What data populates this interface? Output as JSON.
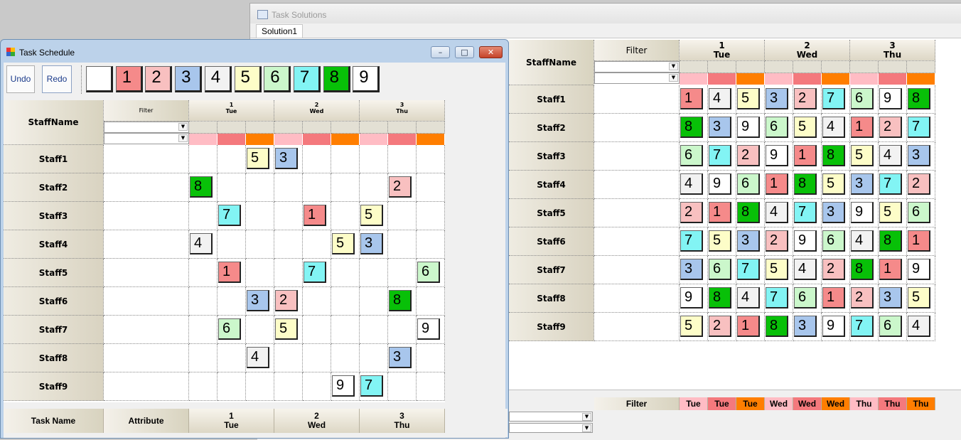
{
  "colors": {
    "1": "#f58a8a",
    "2": "#f8c0c0",
    "3": "#a8c6ec",
    "4": "#f2f2f2",
    "5": "#fdfdc8",
    "6": "#cbf7cb",
    "7": "#82f4f4",
    "8": "#08c008",
    "9": "#ffffff",
    "blank": "#ffffff",
    "pink": "#ffbcc4",
    "red": "#f4797d",
    "orange": "#ff7e00"
  },
  "solutions": {
    "title": "Task Solutions",
    "tab": "Solution1",
    "grid": {
      "header_staff": "StaffName",
      "header_filter": "Filter",
      "days": [
        {
          "num": "1",
          "name": "Tue"
        },
        {
          "num": "2",
          "name": "Wed"
        },
        {
          "num": "3",
          "name": "Thu"
        }
      ],
      "rows": [
        {
          "name": "Staff1",
          "cells": [
            1,
            4,
            5,
            3,
            2,
            7,
            6,
            9,
            8
          ]
        },
        {
          "name": "Staff2",
          "cells": [
            8,
            3,
            9,
            6,
            5,
            4,
            1,
            2,
            7
          ]
        },
        {
          "name": "Staff3",
          "cells": [
            6,
            7,
            2,
            9,
            1,
            8,
            5,
            4,
            3
          ]
        },
        {
          "name": "Staff4",
          "cells": [
            4,
            9,
            6,
            1,
            8,
            5,
            3,
            7,
            2
          ]
        },
        {
          "name": "Staff5",
          "cells": [
            2,
            1,
            8,
            4,
            7,
            3,
            9,
            5,
            6
          ]
        },
        {
          "name": "Staff6",
          "cells": [
            7,
            5,
            3,
            2,
            9,
            6,
            4,
            8,
            1
          ]
        },
        {
          "name": "Staff7",
          "cells": [
            3,
            6,
            7,
            5,
            4,
            2,
            8,
            1,
            9
          ]
        },
        {
          "name": "Staff8",
          "cells": [
            9,
            8,
            4,
            7,
            6,
            1,
            2,
            3,
            5
          ]
        },
        {
          "name": "Staff9",
          "cells": [
            5,
            2,
            1,
            8,
            3,
            9,
            7,
            6,
            4
          ]
        }
      ]
    },
    "lower": {
      "filter": "Filter",
      "columns": [
        "Tue",
        "Tue",
        "Tue",
        "Wed",
        "Wed",
        "Wed",
        "Thu",
        "Thu",
        "Thu"
      ]
    }
  },
  "schedule": {
    "title": "Task Schedule",
    "window_buttons": {
      "min": "–",
      "max": "□",
      "close": "✕"
    },
    "toolbar": {
      "undo": "Undo",
      "redo": "Redo",
      "tiles": [
        "",
        "1",
        "2",
        "3",
        "4",
        "5",
        "6",
        "7",
        "8",
        "9"
      ]
    },
    "grid": {
      "header_staff": "StaffName",
      "header_filter": "Filter",
      "days": [
        {
          "num": "1",
          "name": "Tue"
        },
        {
          "num": "2",
          "name": "Wed"
        },
        {
          "num": "3",
          "name": "Thu"
        }
      ],
      "rows": [
        {
          "name": "Staff1",
          "cells": [
            null,
            null,
            5,
            3,
            null,
            null,
            null,
            null,
            null
          ]
        },
        {
          "name": "Staff2",
          "cells": [
            8,
            null,
            null,
            null,
            null,
            null,
            null,
            2,
            null
          ]
        },
        {
          "name": "Staff3",
          "cells": [
            null,
            7,
            null,
            null,
            1,
            null,
            5,
            null,
            null
          ]
        },
        {
          "name": "Staff4",
          "cells": [
            4,
            null,
            null,
            null,
            null,
            5,
            3,
            null,
            null
          ]
        },
        {
          "name": "Staff5",
          "cells": [
            null,
            1,
            null,
            null,
            7,
            null,
            null,
            null,
            6
          ]
        },
        {
          "name": "Staff6",
          "cells": [
            null,
            null,
            3,
            2,
            null,
            null,
            null,
            8,
            null
          ]
        },
        {
          "name": "Staff7",
          "cells": [
            null,
            6,
            null,
            5,
            null,
            null,
            null,
            null,
            9
          ]
        },
        {
          "name": "Staff8",
          "cells": [
            null,
            null,
            4,
            null,
            null,
            null,
            null,
            3,
            null
          ]
        },
        {
          "name": "Staff9",
          "cells": [
            null,
            null,
            null,
            null,
            null,
            9,
            7,
            null,
            null
          ]
        }
      ]
    },
    "lower": {
      "task_name": "Task Name",
      "attribute": "Attribute",
      "days": [
        {
          "num": "1",
          "name": "Tue"
        },
        {
          "num": "2",
          "name": "Wed"
        },
        {
          "num": "3",
          "name": "Thu"
        }
      ]
    }
  }
}
